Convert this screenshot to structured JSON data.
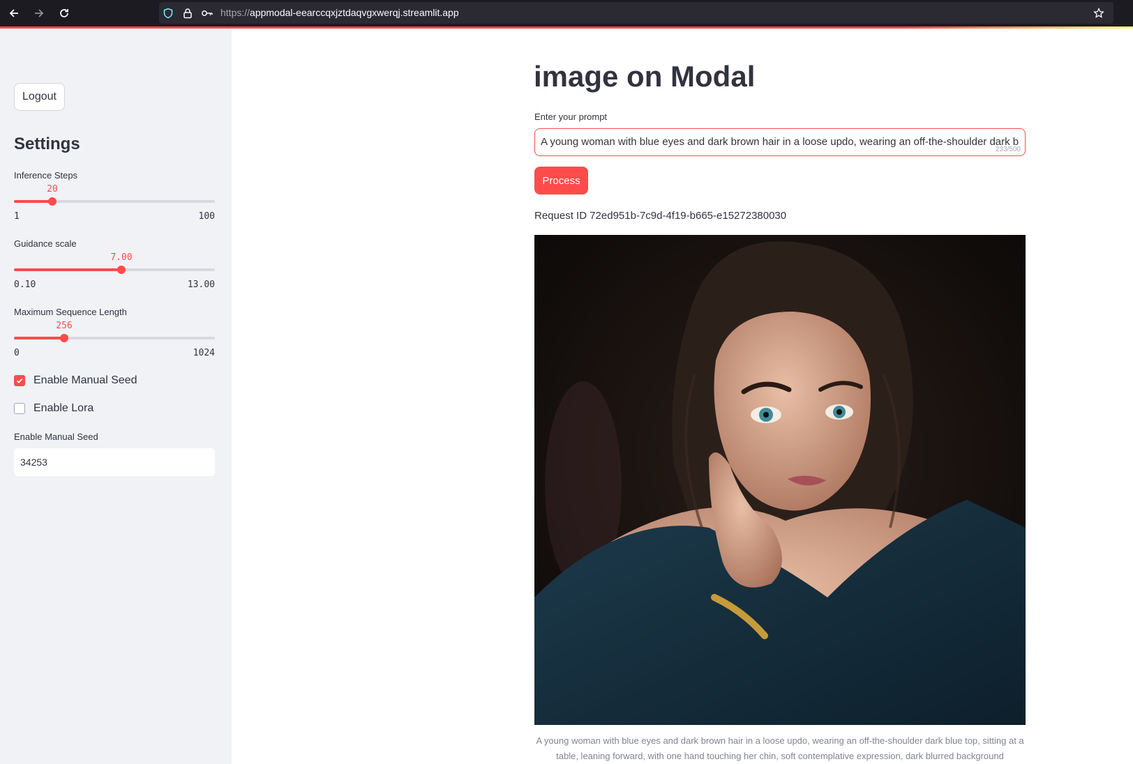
{
  "browser": {
    "url_scheme": "https://",
    "url_host": "appmodal-eearccqxjztdaqvgxwerqj.streamlit.app"
  },
  "sidebar": {
    "logout_label": "Logout",
    "settings_title": "Settings",
    "sliders": [
      {
        "label": "Inference Steps",
        "value": "20",
        "min": "1",
        "max": "100",
        "fraction": 0.192
      },
      {
        "label": "Guidance scale",
        "value": "7.00",
        "min": "0.10",
        "max": "13.00",
        "fraction": 0.535
      },
      {
        "label": "Maximum Sequence Length",
        "value": "256",
        "min": "0",
        "max": "1024",
        "fraction": 0.25
      }
    ],
    "checkboxes": [
      {
        "label": "Enable Manual Seed",
        "checked": true
      },
      {
        "label": "Enable Lora",
        "checked": false
      }
    ],
    "seed_label": "Enable Manual Seed",
    "seed_value": "34253"
  },
  "main": {
    "title": "image on Modal",
    "prompt_label": "Enter your prompt",
    "prompt_value": "A young woman with blue eyes and dark brown hair in a loose updo, wearing an off-the-shoulder dark b",
    "char_count": "233/500",
    "process_label": "Process",
    "request_id": "Request ID 72ed951b-7c9d-4f19-b665-e15272380030",
    "caption": "A young woman with blue eyes and dark brown hair in a loose updo, wearing an off-the-shoulder dark blue top, sitting at a table, leaning forward, with one hand touching her chin, soft contemplative expression, dark blurred background"
  },
  "colors": {
    "accent": "#ff4b4b",
    "sidebar_bg": "#f0f2f6",
    "text": "#31333f",
    "browser_bg": "#1c1b22"
  }
}
